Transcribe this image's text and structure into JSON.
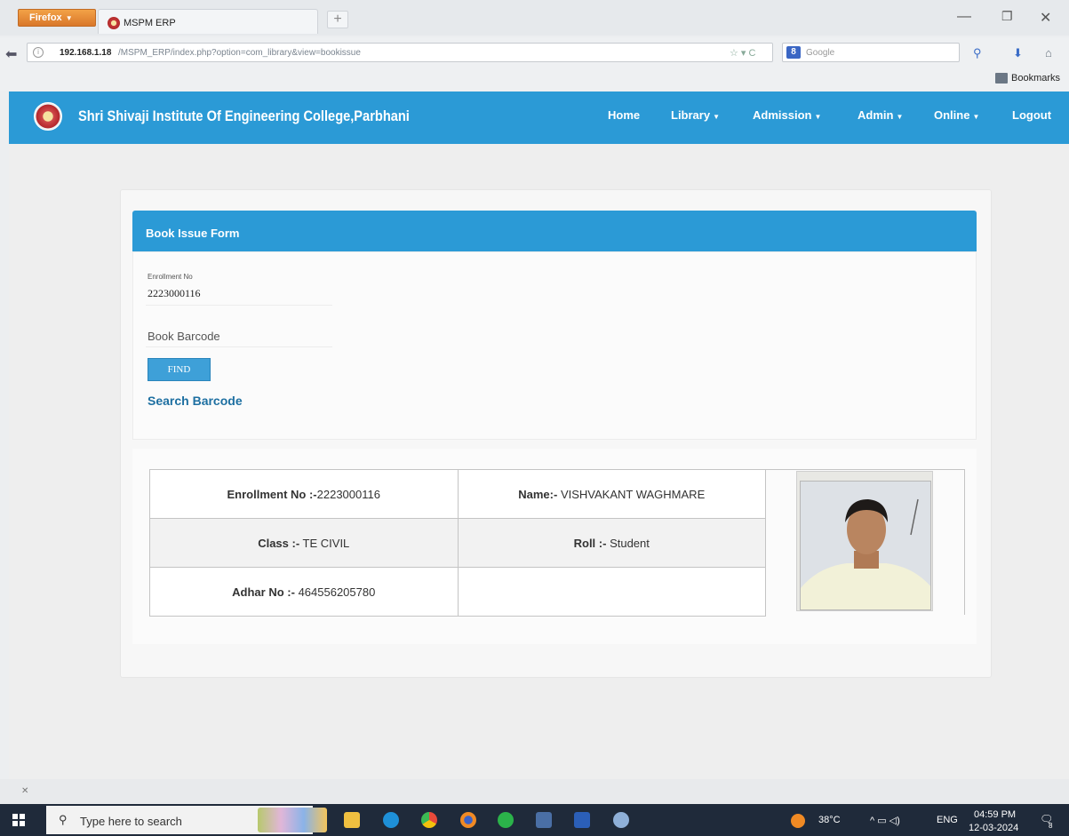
{
  "browser": {
    "menu_button": "Firefox",
    "tab_title": "MSPM ERP",
    "new_tab": "+",
    "url_host": "192.168.1.18",
    "url_path": "/MSPM_ERP/index.php?option=com_library&view=bookissue",
    "search_placeholder": "Google",
    "bookmarks_label": "Bookmarks"
  },
  "header": {
    "college_name": "Shri Shivaji Institute Of Engineering College,Parbhani",
    "menu": [
      "Home",
      "Library",
      "Admission",
      "Admin",
      "Online",
      "Logout"
    ],
    "accent_color": "#2b9ad6"
  },
  "form": {
    "title": "Book Issue Form",
    "enrollment_label": "Enrollment No",
    "enrollment_value": "2223000116",
    "barcode_placeholder": "Book Barcode",
    "find_button": "FIND",
    "search_link": "Search Barcode"
  },
  "student": {
    "enrollment_label": "Enrollment No :-",
    "enrollment_value": "2223000116",
    "name_label": "Name:-",
    "name_value": "VISHVAKANT WAGHMARE",
    "class_label": "Class :-",
    "class_value": "TE CIVIL",
    "roll_label": "Roll :-",
    "roll_value": "Student",
    "adhar_label": "Adhar No :-",
    "adhar_value": "464556205780"
  },
  "taskbar": {
    "search_placeholder": "Type here to search",
    "temperature": "38°C",
    "language": "ENG",
    "time": "04:59 PM",
    "date": "12-03-2024",
    "notification_badge": "8"
  }
}
